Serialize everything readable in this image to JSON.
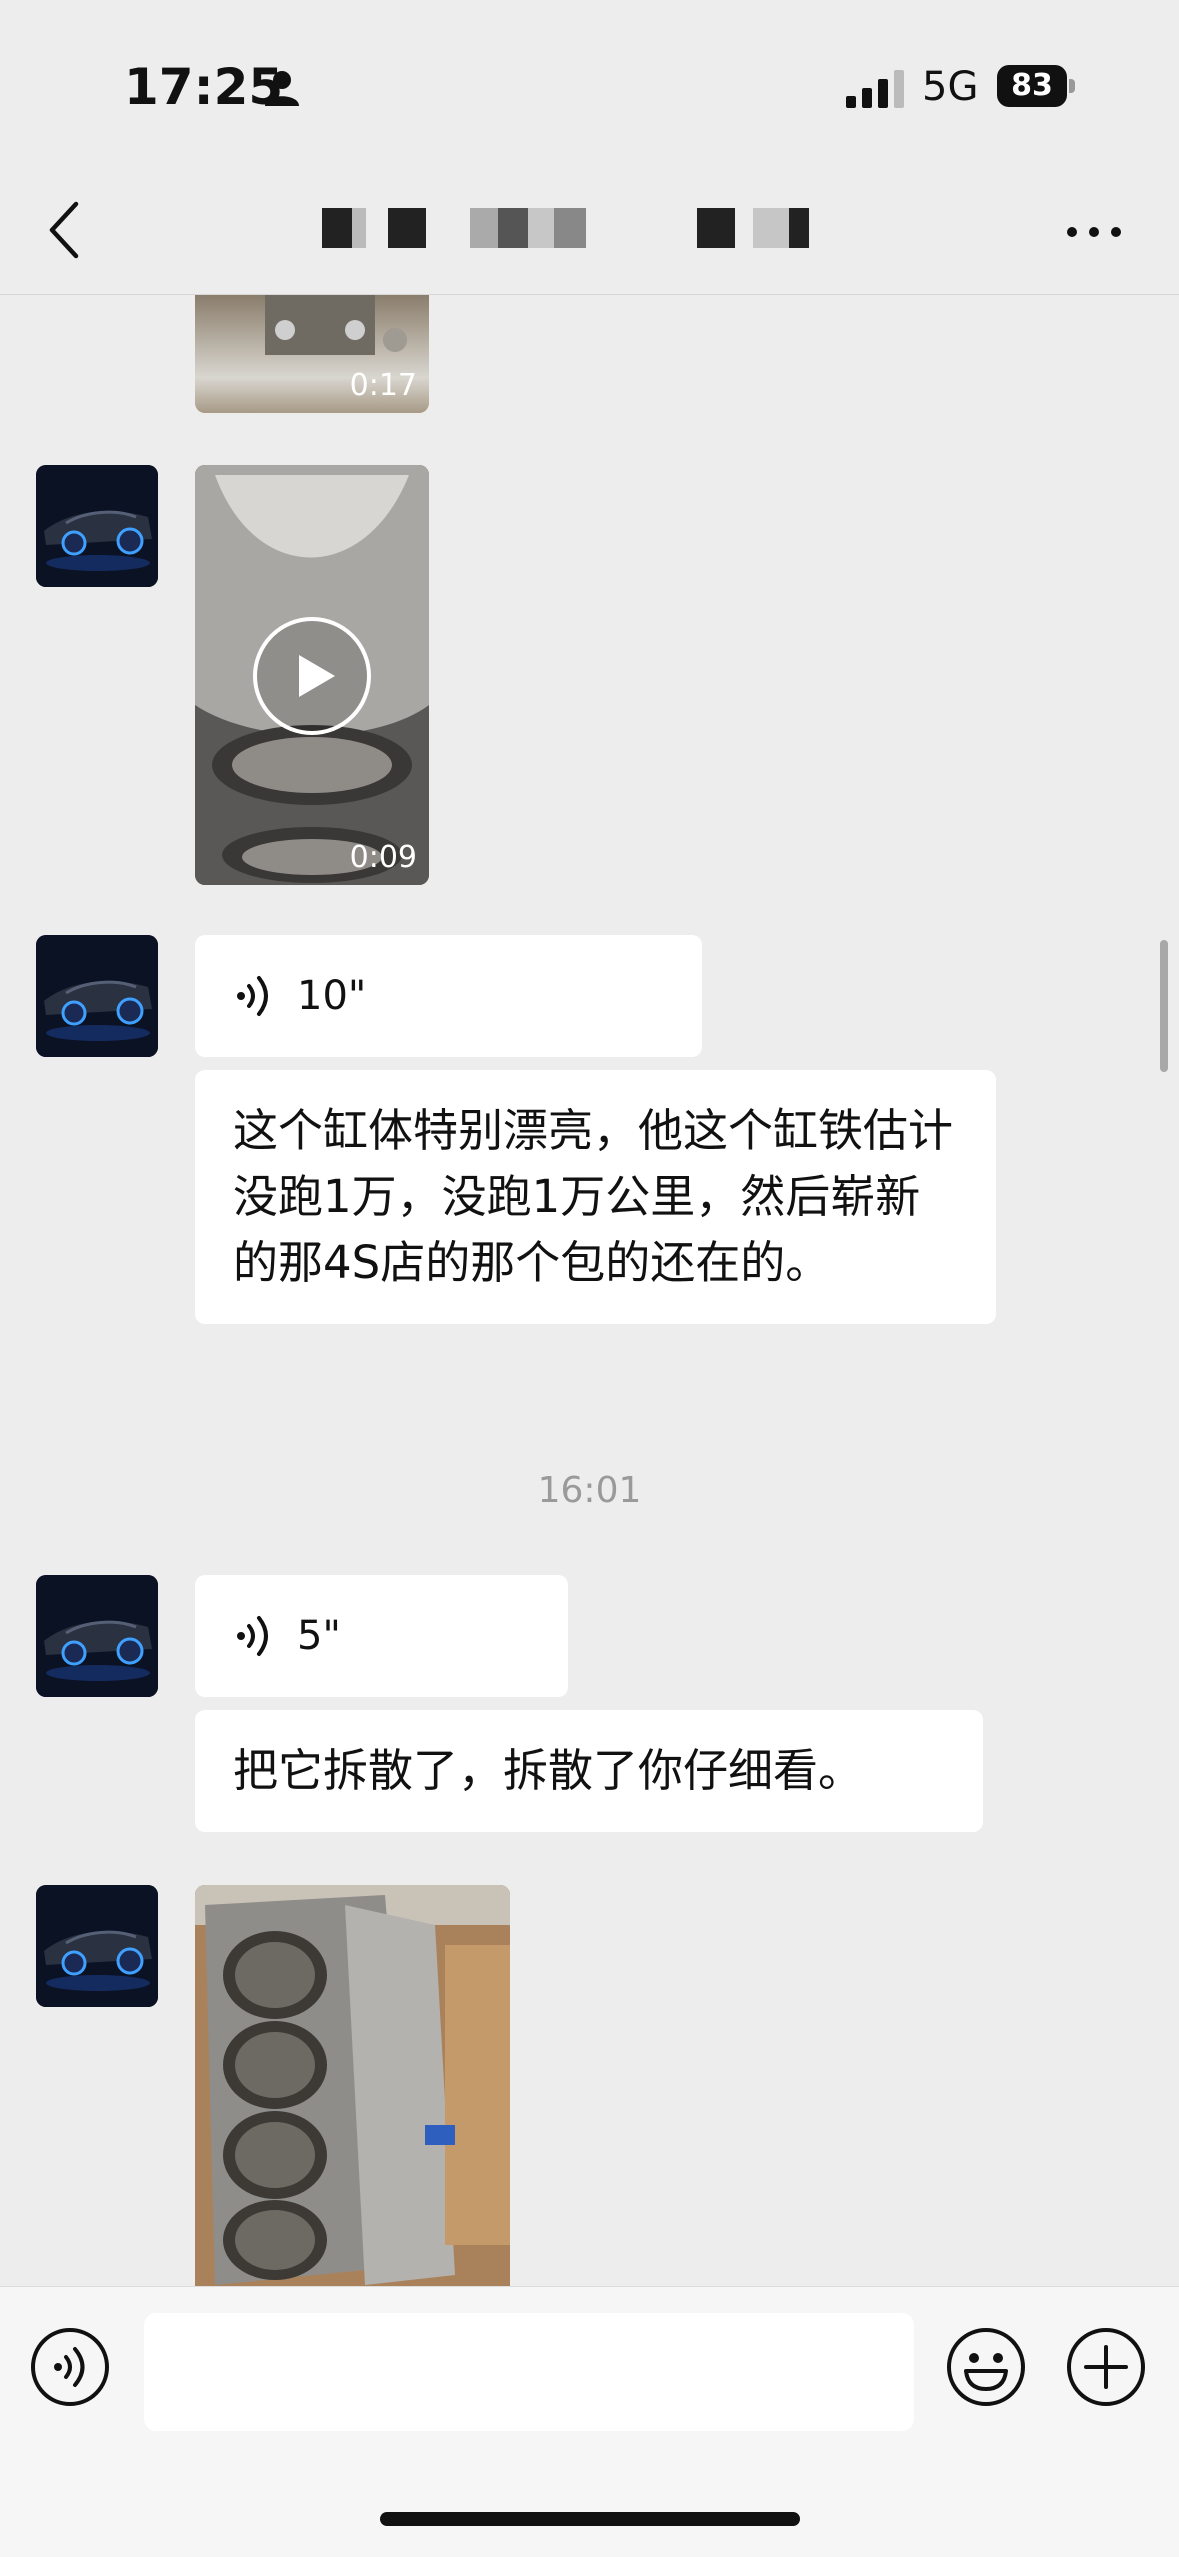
{
  "status": {
    "time": "17:25",
    "network": "5G",
    "battery": "83"
  },
  "chat": {
    "video1_duration": "0:17",
    "video2_duration": "0:09",
    "voice1": "10\"",
    "text1": "这个缸体特别漂亮，他这个缸铁估计没跑1万，没跑1万公里，然后崭新的那4S店的那个包的还在的。",
    "timestamp": "16:01",
    "voice2": "5\"",
    "text2": "把它拆散了，拆散了你仔细看。"
  },
  "icons": [
    "person-icon",
    "signal-icon",
    "battery-icon",
    "back-icon",
    "more-icon",
    "play-icon",
    "voice-icon",
    "emoji-icon",
    "plus-icon"
  ]
}
